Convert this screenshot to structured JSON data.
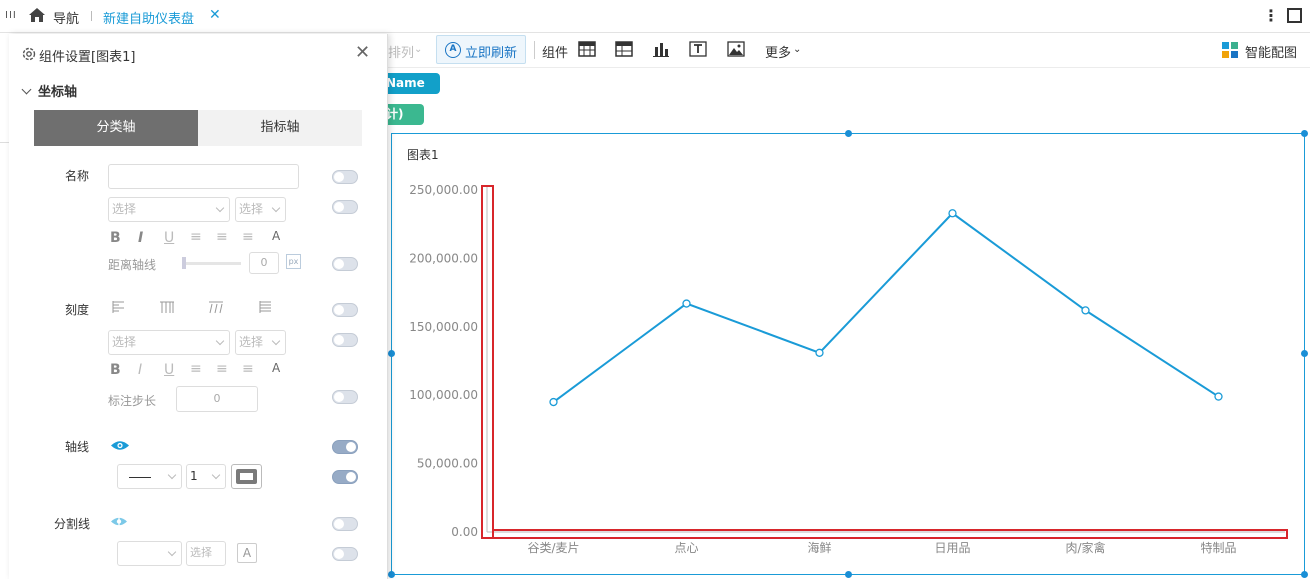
{
  "topbar": {
    "menu_glyph": "III",
    "nav_label": "导航",
    "tab_label": "新建自助仪表盘",
    "tab_close": "✕",
    "more_glyph": "⋮"
  },
  "toolbar": {
    "arrange_label": "排列",
    "refresh_label": "立即刷新",
    "refresh_icon_text": "A",
    "widgets_label": "组件",
    "more_label": "更多",
    "smart_label": "智能配图"
  },
  "chips": {
    "dimension": "Name",
    "measure": "计)"
  },
  "panel": {
    "title": "组件设置[图表1]",
    "close": "✕",
    "section": "坐标轴",
    "tab_category": "分类轴",
    "tab_value": "指标轴",
    "name_label": "名称",
    "name_value": "",
    "select_placeholder": "选择",
    "axis_distance_label": "距离轴线",
    "axis_distance_value": "0",
    "px_unit": "px",
    "tick_label": "刻度",
    "label_step_label": "标注步长",
    "label_step_value": "0",
    "axis_line_label": "轴线",
    "line_width_value": "1",
    "split_line_label": "分割线",
    "fmt": [
      "B",
      "I",
      "U",
      "≡",
      "≡",
      "≡",
      "A"
    ],
    "colors": {
      "eye": "#1a9bd7",
      "toggle_on": "#97abc6"
    },
    "toggles": {
      "name": false,
      "name_font": false,
      "distance": false,
      "tick": false,
      "tick_font": false,
      "step": false,
      "axis_line": true,
      "axis_line_style": true,
      "split": false,
      "split_style": false
    }
  },
  "chart_data": {
    "type": "line",
    "title": "图表1",
    "categories": [
      "谷类/麦片",
      "点心",
      "海鲜",
      "日用品",
      "肉/家禽",
      "特制品"
    ],
    "values": [
      95000,
      167000,
      131000,
      233000,
      162000,
      99000
    ],
    "yticks": [
      "0.00",
      "50,000.00",
      "100,000.00",
      "150,000.00",
      "200,000.00",
      "250,000.00"
    ],
    "ylim": [
      0,
      250000
    ],
    "line_color": "#1a9bd7",
    "grid": false,
    "legend": "none"
  }
}
